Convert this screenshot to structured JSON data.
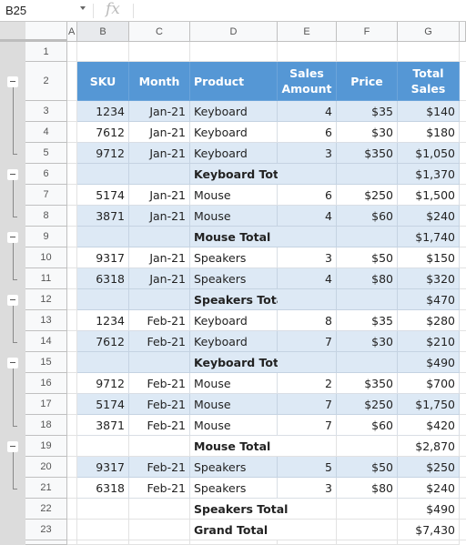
{
  "formula_bar": {
    "name_box": "B25",
    "fx_label": "fx",
    "formula": ""
  },
  "columns": [
    "A",
    "B",
    "C",
    "D",
    "E",
    "F",
    "G"
  ],
  "selected_column": "B",
  "table_header": {
    "row": "2",
    "sku": "SKU",
    "month": "Month",
    "product": "Product",
    "sales_amount_1": "Sales",
    "sales_amount_2": "Amount",
    "price": "Price",
    "total_sales_1": "Total",
    "total_sales_2": "Sales"
  },
  "rows": [
    {
      "num": "1",
      "type": "empty"
    },
    {
      "num": "2",
      "type": "header"
    },
    {
      "num": "3",
      "type": "data",
      "band": true,
      "sku": "1234",
      "month": "Jan-21",
      "product": "Keyboard",
      "qty": "4",
      "price": "$35",
      "total": "$140"
    },
    {
      "num": "4",
      "type": "data",
      "band": false,
      "sku": "7612",
      "month": "Jan-21",
      "product": "Keyboard",
      "qty": "6",
      "price": "$30",
      "total": "$180"
    },
    {
      "num": "5",
      "type": "data",
      "band": true,
      "sku": "9712",
      "month": "Jan-21",
      "product": "Keyboard",
      "qty": "3",
      "price": "$350",
      "total": "$1,050"
    },
    {
      "num": "6",
      "type": "subtotal",
      "band": true,
      "label": "Keyboard Total",
      "total": "$1,370"
    },
    {
      "num": "7",
      "type": "data",
      "band": false,
      "sku": "5174",
      "month": "Jan-21",
      "product": "Mouse",
      "qty": "6",
      "price": "$250",
      "total": "$1,500"
    },
    {
      "num": "8",
      "type": "data",
      "band": true,
      "sku": "3871",
      "month": "Jan-21",
      "product": "Mouse",
      "qty": "4",
      "price": "$60",
      "total": "$240"
    },
    {
      "num": "9",
      "type": "subtotal",
      "band": true,
      "label": "Mouse Total",
      "total": "$1,740"
    },
    {
      "num": "10",
      "type": "data",
      "band": false,
      "sku": "9317",
      "month": "Jan-21",
      "product": "Speakers",
      "qty": "3",
      "price": "$50",
      "total": "$150"
    },
    {
      "num": "11",
      "type": "data",
      "band": true,
      "sku": "6318",
      "month": "Jan-21",
      "product": "Speakers",
      "qty": "4",
      "price": "$80",
      "total": "$320"
    },
    {
      "num": "12",
      "type": "subtotal",
      "band": true,
      "label": "Speakers Total",
      "total": "$470"
    },
    {
      "num": "13",
      "type": "data",
      "band": false,
      "sku": "1234",
      "month": "Feb-21",
      "product": "Keyboard",
      "qty": "8",
      "price": "$35",
      "total": "$280"
    },
    {
      "num": "14",
      "type": "data",
      "band": true,
      "sku": "7612",
      "month": "Feb-21",
      "product": "Keyboard",
      "qty": "7",
      "price": "$30",
      "total": "$210"
    },
    {
      "num": "15",
      "type": "subtotal",
      "band": true,
      "label": "Keyboard Total",
      "total": "$490"
    },
    {
      "num": "16",
      "type": "data",
      "band": false,
      "sku": "9712",
      "month": "Feb-21",
      "product": "Mouse",
      "qty": "2",
      "price": "$350",
      "total": "$700"
    },
    {
      "num": "17",
      "type": "data",
      "band": true,
      "sku": "5174",
      "month": "Feb-21",
      "product": "Mouse",
      "qty": "7",
      "price": "$250",
      "total": "$1,750"
    },
    {
      "num": "18",
      "type": "data",
      "band": false,
      "sku": "3871",
      "month": "Feb-21",
      "product": "Mouse",
      "qty": "7",
      "price": "$60",
      "total": "$420"
    },
    {
      "num": "19",
      "type": "subtotal",
      "band": false,
      "label": "Mouse Total",
      "total": "$2,870"
    },
    {
      "num": "20",
      "type": "data",
      "band": true,
      "sku": "9317",
      "month": "Feb-21",
      "product": "Speakers",
      "qty": "5",
      "price": "$50",
      "total": "$250"
    },
    {
      "num": "21",
      "type": "data",
      "band": false,
      "sku": "6318",
      "month": "Feb-21",
      "product": "Speakers",
      "qty": "3",
      "price": "$80",
      "total": "$240"
    },
    {
      "num": "22",
      "type": "subtotal",
      "band": false,
      "label": "Speakers Total",
      "total": "$490"
    },
    {
      "num": "23",
      "type": "subtotal",
      "band": false,
      "label": "Grand Total",
      "total": "$7,430"
    }
  ],
  "colors": {
    "header_blue": "#5597d5",
    "band_blue": "#dde9f5"
  },
  "outline_groups": [
    {
      "button_row": "2",
      "icon": "minus-icon"
    },
    {
      "button_row": "6",
      "icon": "minus-icon"
    },
    {
      "button_row": "9",
      "icon": "minus-icon"
    },
    {
      "button_row": "12",
      "icon": "minus-icon"
    },
    {
      "button_row": "15",
      "icon": "minus-icon"
    },
    {
      "button_row": "19",
      "icon": "minus-icon"
    }
  ]
}
